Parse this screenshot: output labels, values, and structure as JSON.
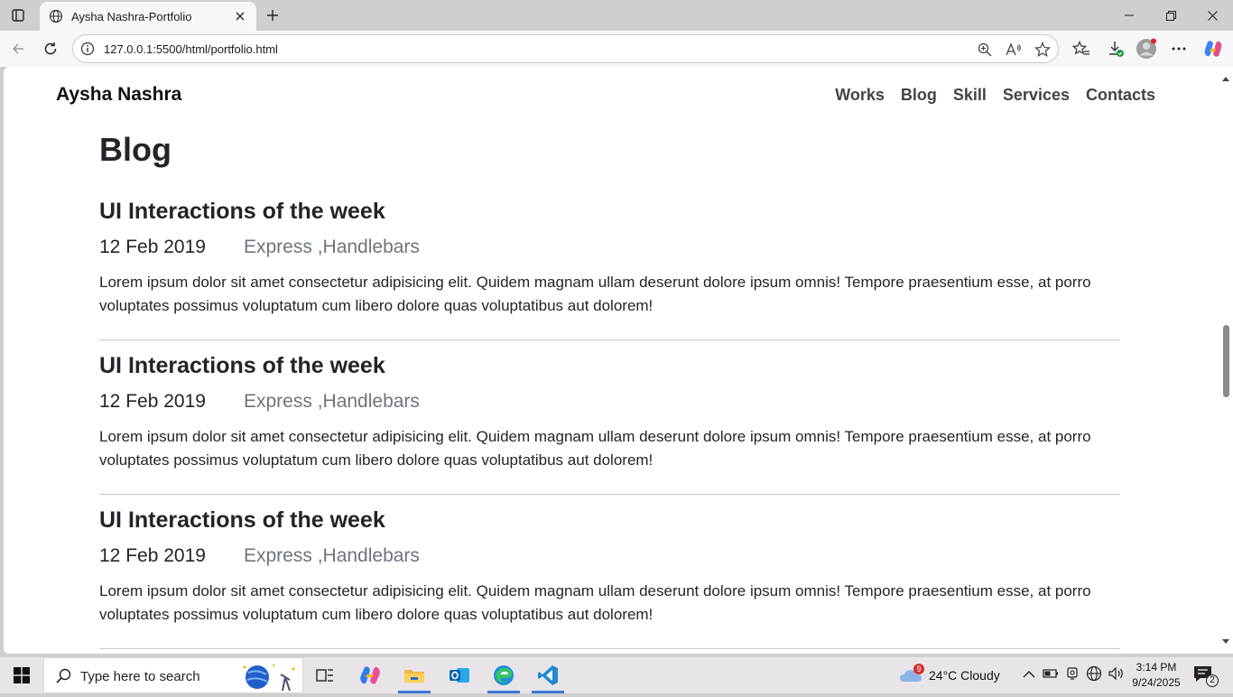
{
  "browser": {
    "tab_title": "Aysha Nashra-Portfolio",
    "url": "127.0.0.1:5500/html/portfolio.html"
  },
  "page": {
    "brand": "Aysha Nashra",
    "nav": [
      {
        "label": "Works"
      },
      {
        "label": "Blog"
      },
      {
        "label": "Skill"
      },
      {
        "label": "Services"
      },
      {
        "label": "Contacts"
      }
    ],
    "section_title": "Blog",
    "posts": [
      {
        "title": "UI Interactions of the week",
        "date": "12 Feb 2019",
        "tags": "Express ,Handlebars",
        "body": "Lorem ipsum dolor sit amet consectetur adipisicing elit. Quidem magnam ullam deserunt dolore ipsum omnis! Tempore praesentium esse, at porro voluptates possimus voluptatum cum libero dolore quas voluptatibus aut dolorem!"
      },
      {
        "title": "UI Interactions of the week",
        "date": "12 Feb 2019",
        "tags": "Express ,Handlebars",
        "body": "Lorem ipsum dolor sit amet consectetur adipisicing elit. Quidem magnam ullam deserunt dolore ipsum omnis! Tempore praesentium esse, at porro voluptates possimus voluptatum cum libero dolore quas voluptatibus aut dolorem!"
      },
      {
        "title": "UI Interactions of the week",
        "date": "12 Feb 2019",
        "tags": "Express ,Handlebars",
        "body": "Lorem ipsum dolor sit amet consectetur adipisicing elit. Quidem magnam ullam deserunt dolore ipsum omnis! Tempore praesentium esse, at porro voluptates possimus voluptatum cum libero dolore quas voluptatibus aut dolorem!"
      }
    ]
  },
  "taskbar": {
    "search_placeholder": "Type here to search",
    "weather": "24°C  Cloudy",
    "weather_badge": "9",
    "time": "3:14 PM",
    "date": "9/24/2025",
    "notification_count": "2"
  },
  "colors": {
    "accent": "#3b78d8",
    "tag_gray": "#6c757d",
    "text_dark": "#212529"
  }
}
